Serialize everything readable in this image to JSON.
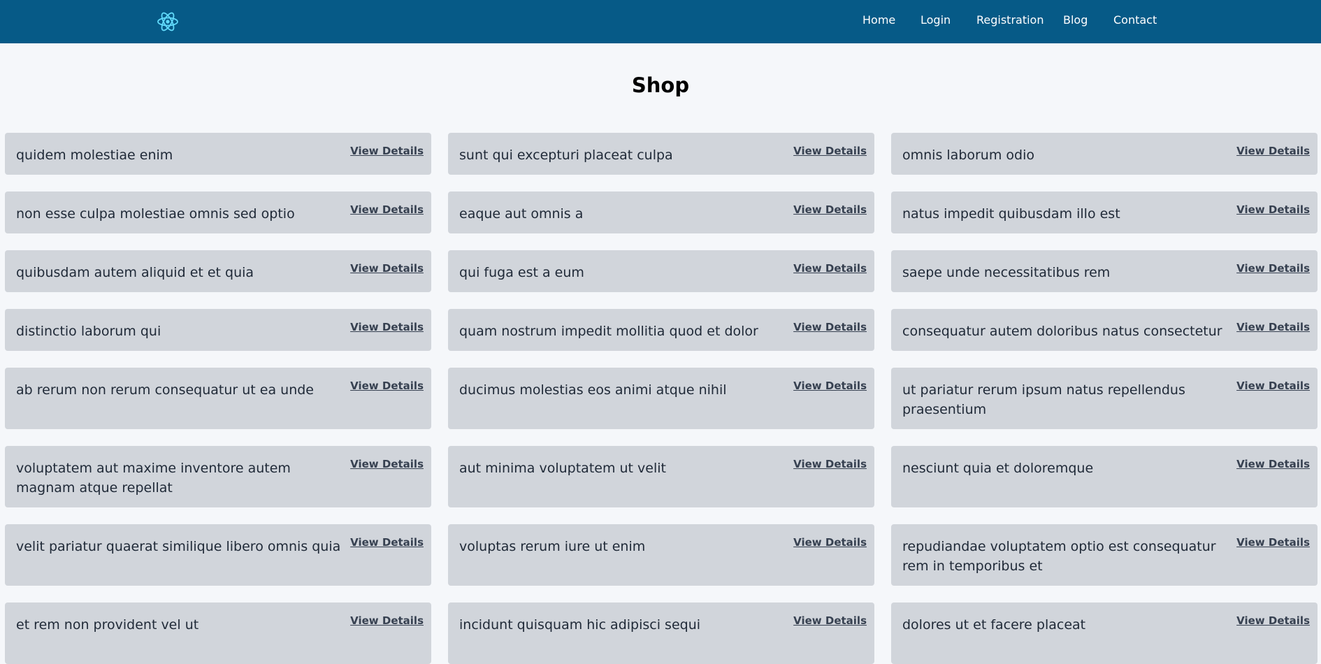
{
  "nav": {
    "logo_icon": "react-atom-icon",
    "links": [
      "Home",
      "Login",
      "Registration",
      "Blog",
      "Contact"
    ]
  },
  "page": {
    "title": "Shop"
  },
  "products": [
    {
      "title": "quidem molestiae enim",
      "link": "View Details"
    },
    {
      "title": "sunt qui excepturi placeat culpa",
      "link": "View Details"
    },
    {
      "title": "omnis laborum odio",
      "link": "View Details"
    },
    {
      "title": "non esse culpa molestiae omnis sed optio",
      "link": "View Details"
    },
    {
      "title": "eaque aut omnis a",
      "link": "View Details"
    },
    {
      "title": "natus impedit quibusdam illo est",
      "link": "View Details"
    },
    {
      "title": "quibusdam autem aliquid et et quia",
      "link": "View Details"
    },
    {
      "title": "qui fuga est a eum",
      "link": "View Details"
    },
    {
      "title": "saepe unde necessitatibus rem",
      "link": "View Details"
    },
    {
      "title": "distinctio laborum qui",
      "link": "View Details"
    },
    {
      "title": "quam nostrum impedit mollitia quod et dolor",
      "link": "View Details"
    },
    {
      "title": "consequatur autem doloribus natus consectetur",
      "link": "View Details"
    },
    {
      "title": "ab rerum non rerum consequatur ut ea unde",
      "link": "View Details"
    },
    {
      "title": "ducimus molestias eos animi atque nihil",
      "link": "View Details"
    },
    {
      "title": "ut pariatur rerum ipsum natus repellendus praesentium",
      "link": "View Details"
    },
    {
      "title": "voluptatem aut maxime inventore autem magnam atque repellat",
      "link": "View Details"
    },
    {
      "title": "aut minima voluptatem ut velit",
      "link": "View Details"
    },
    {
      "title": "nesciunt quia et doloremque",
      "link": "View Details"
    },
    {
      "title": "velit pariatur quaerat similique libero omnis quia",
      "link": "View Details"
    },
    {
      "title": "voluptas rerum iure ut enim",
      "link": "View Details"
    },
    {
      "title": "repudiandae voluptatem optio est consequatur rem in temporibus et",
      "link": "View Details"
    },
    {
      "title": "et rem non provident vel ut",
      "link": "View Details"
    },
    {
      "title": "incidunt quisquam hic adipisci sequi",
      "link": "View Details"
    },
    {
      "title": "dolores ut et facere placeat",
      "link": "View Details"
    }
  ],
  "colors": {
    "navbar": "#065a87",
    "card": "#d1d5db",
    "background": "#f5f7fa",
    "logo": "#61dafb"
  }
}
